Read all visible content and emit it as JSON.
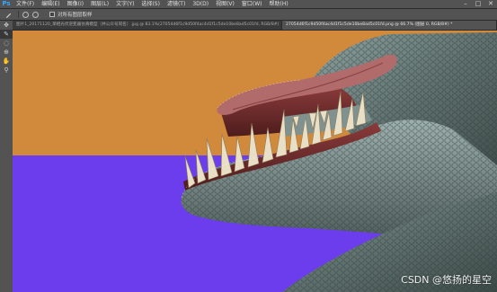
{
  "app": {
    "logo": "Ps"
  },
  "menu": {
    "items": [
      "文件(F)",
      "编辑(E)",
      "图像(I)",
      "图层(L)",
      "文字(Y)",
      "选择(S)",
      "滤镜(T)",
      "3D(D)",
      "视图(V)",
      "窗口(W)",
      "帮助(H)"
    ]
  },
  "window_controls": {
    "minimize": "–",
    "maximize": "□",
    "close": "✕"
  },
  "options": {
    "checkbox_label": "对所有图层取样"
  },
  "tabs": [
    {
      "label": "图片1_20171120_单相光伏逆变器仿真模型（并公众号同名）.jpg @ 83.1%(27054d6f1c9d50f4ac4d1f1c5de10be8ad5c01fd, RGB/8#)",
      "active": false
    },
    {
      "label": "27054d6f1c9d50f4ac4d1f1c5de10be8ad5c01fd.png @ 66.7% (图层 0, RGB/8#) *",
      "active": true
    }
  ],
  "tools": [
    "move-icon",
    "brush-icon",
    "lasso-icon",
    "stamp-icon",
    "hand-icon",
    "zoom-icon"
  ],
  "tool_glyphs": [
    "✥",
    "✎",
    "◌",
    "⊕",
    "✋",
    "⚲"
  ],
  "canvas": {
    "colors": {
      "top_band": "#d1893b",
      "bottom_band": "#6b3ded"
    }
  },
  "watermark": "CSDN @悠扬的星空"
}
